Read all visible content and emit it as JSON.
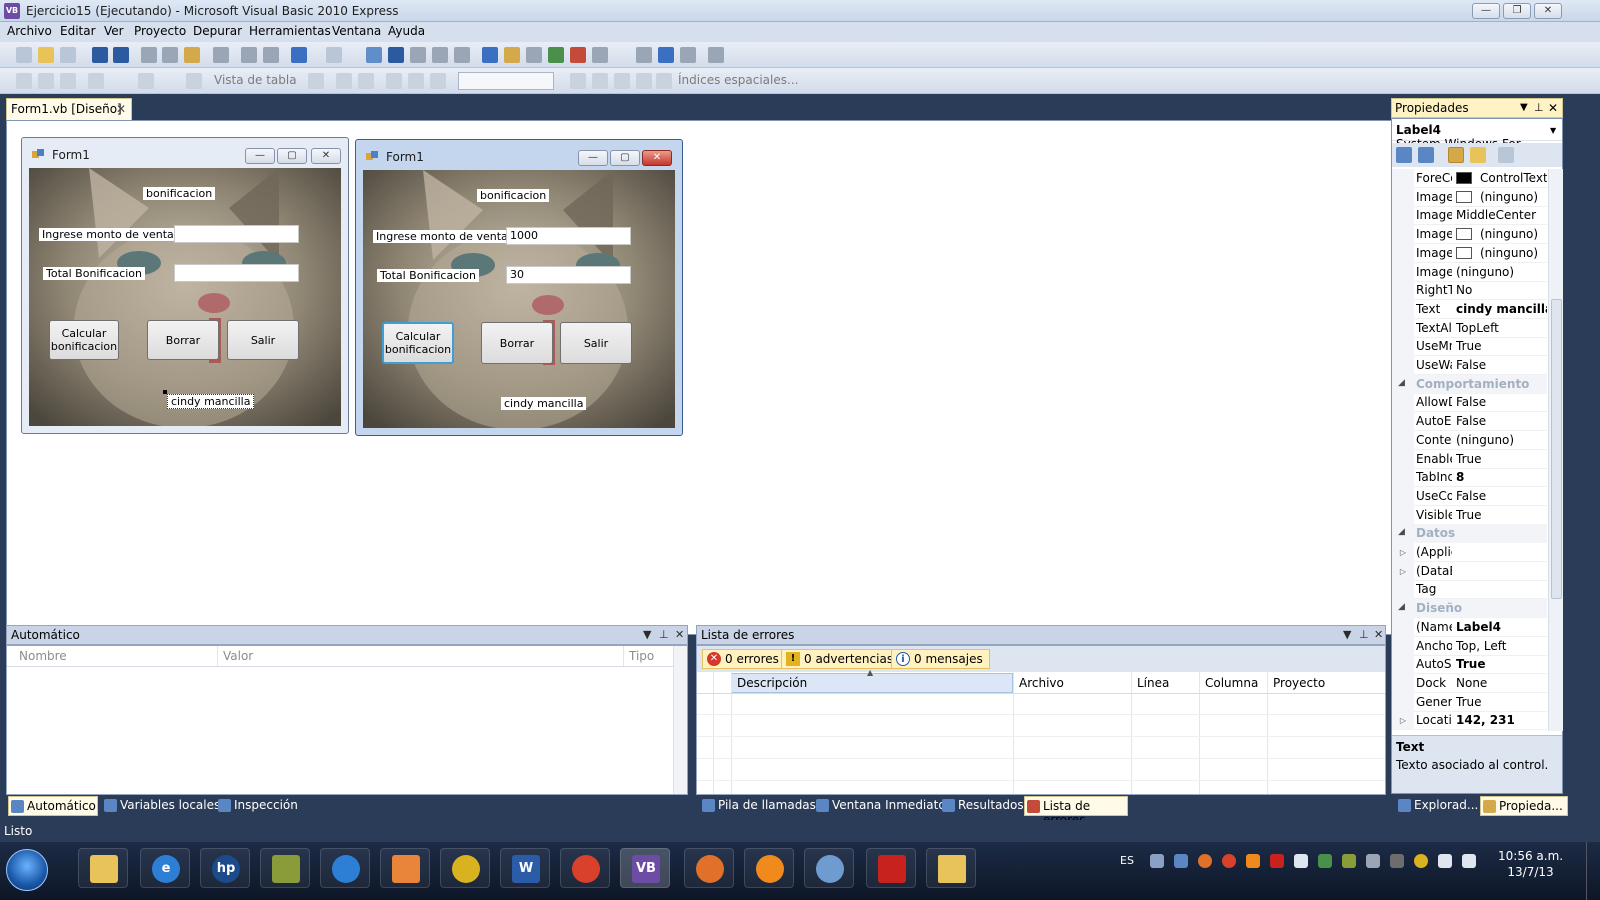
{
  "window": {
    "title": "Ejercicio15 (Ejecutando) - Microsoft Visual Basic 2010 Express",
    "app_icon_text": "VB"
  },
  "menu": [
    "Archivo",
    "Editar",
    "Ver",
    "Proyecto",
    "Depurar",
    "Herramientas",
    "Ventana",
    "Ayuda"
  ],
  "toolbar2": {
    "table_view": "Vista de tabla",
    "spatial_indexes": "Índices espaciales..."
  },
  "document_tab": {
    "label": "Form1.vb [Diseño]"
  },
  "designer_form": {
    "title": "Form1",
    "label_bonificacion": "bonificacion",
    "label_ingrese": "Ingrese monto de venta",
    "label_total": "Total Bonificacion",
    "btn_calcular": "Calcular bonificacion",
    "btn_borrar": "Borrar",
    "btn_salir": "Salir",
    "label_author": "cindy mancilla"
  },
  "running_form": {
    "title": "Form1",
    "label_bonificacion": "bonificacion",
    "label_ingrese": "Ingrese monto de venta",
    "input_monto": "1000",
    "label_total": "Total Bonificacion",
    "input_total": "30",
    "btn_calcular": "Calcular bonificacion",
    "btn_borrar": "Borrar",
    "btn_salir": "Salir",
    "label_author": "cindy mancilla"
  },
  "auto_panel": {
    "title": "Automático",
    "columns": [
      "Nombre",
      "Valor",
      "Tipo"
    ]
  },
  "error_panel": {
    "title": "Lista de errores",
    "filters": {
      "errors": "0 errores",
      "warnings": "0 advertencias",
      "messages": "0 mensajes"
    },
    "columns": [
      "Descripción",
      "Archivo",
      "Línea",
      "Columna",
      "Proyecto"
    ]
  },
  "bottom_tabs_left": [
    "Automático",
    "Variables locales",
    "Inspección"
  ],
  "bottom_tabs_right": [
    "Pila de llamadas",
    "Ventana Inmediato",
    "Resultados",
    "Lista de errores"
  ],
  "properties": {
    "title": "Propiedades",
    "selected_object": "Label4",
    "selected_type": "System.Windows.For",
    "rows": [
      {
        "name": "ForeColor",
        "value": "ControlText",
        "swatch": "#000000"
      },
      {
        "name": "Image",
        "value": "(ninguno)",
        "swatch": "#ffffff"
      },
      {
        "name": "ImageAlign",
        "value": "MiddleCenter"
      },
      {
        "name": "ImageIndex",
        "value": "(ninguno)",
        "swatch": "#ffffff"
      },
      {
        "name": "ImageKey",
        "value": "(ninguno)",
        "swatch": "#ffffff"
      },
      {
        "name": "ImageList",
        "value": "(ninguno)"
      },
      {
        "name": "RightToLeft",
        "value": "No"
      },
      {
        "name": "Text",
        "value": "cindy mancilla",
        "bold": true
      },
      {
        "name": "TextAlign",
        "value": "TopLeft"
      },
      {
        "name": "UseMnemonic",
        "value": "True"
      },
      {
        "name": "UseWaitCursor",
        "value": "False"
      }
    ],
    "cat_behavior": "Comportamiento",
    "behavior_rows": [
      {
        "name": "AllowDrop",
        "value": "False"
      },
      {
        "name": "AutoEllipsis",
        "value": "False"
      },
      {
        "name": "ContextMenuStrip",
        "value": "(ninguno)"
      },
      {
        "name": "Enabled",
        "value": "True"
      },
      {
        "name": "TabIndex",
        "value": "8",
        "bold": true
      },
      {
        "name": "UseCompatibleTextRendering",
        "value": "False"
      },
      {
        "name": "Visible",
        "value": "True"
      }
    ],
    "cat_data": "Datos",
    "data_rows": [
      {
        "name": "(ApplicationSettings)",
        "value": "",
        "expander": true
      },
      {
        "name": "(DataBindings)",
        "value": "",
        "expander": true
      },
      {
        "name": "Tag",
        "value": ""
      }
    ],
    "cat_design": "Diseño",
    "design_rows": [
      {
        "name": "(Name)",
        "value": "Label4",
        "bold": true
      },
      {
        "name": "Anchor",
        "value": "Top, Left"
      },
      {
        "name": "AutoSize",
        "value": "True",
        "bold": true
      },
      {
        "name": "Dock",
        "value": "None"
      },
      {
        "name": "GenerateMember",
        "value": "True"
      },
      {
        "name": "Location",
        "value": "142, 231",
        "bold": true,
        "expander": true
      }
    ],
    "desc_title": "Text",
    "desc_text": "Texto asociado al control.",
    "bottom_tab_explorer": "Explorad...",
    "bottom_tab_props": "Propieda..."
  },
  "status": "Listo",
  "taskbar": {
    "language": "ES",
    "time": "10:56 a.m.",
    "date": "13/7/13"
  }
}
